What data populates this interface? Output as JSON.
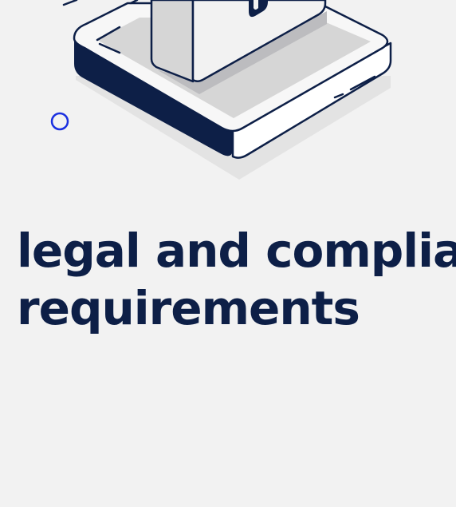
{
  "headline": {
    "line1": "legal and complian",
    "line2": "requirements"
  },
  "colors": {
    "background": "#f2f2f2",
    "navy": "#0d1f47",
    "accent_blue": "#1a2fe0",
    "platform_light": "#d6d6d6",
    "shadow": "#e3e3e3"
  },
  "icons": {
    "illustration": "isometric-lock-on-platform",
    "dot": "blue-ring-dot"
  }
}
